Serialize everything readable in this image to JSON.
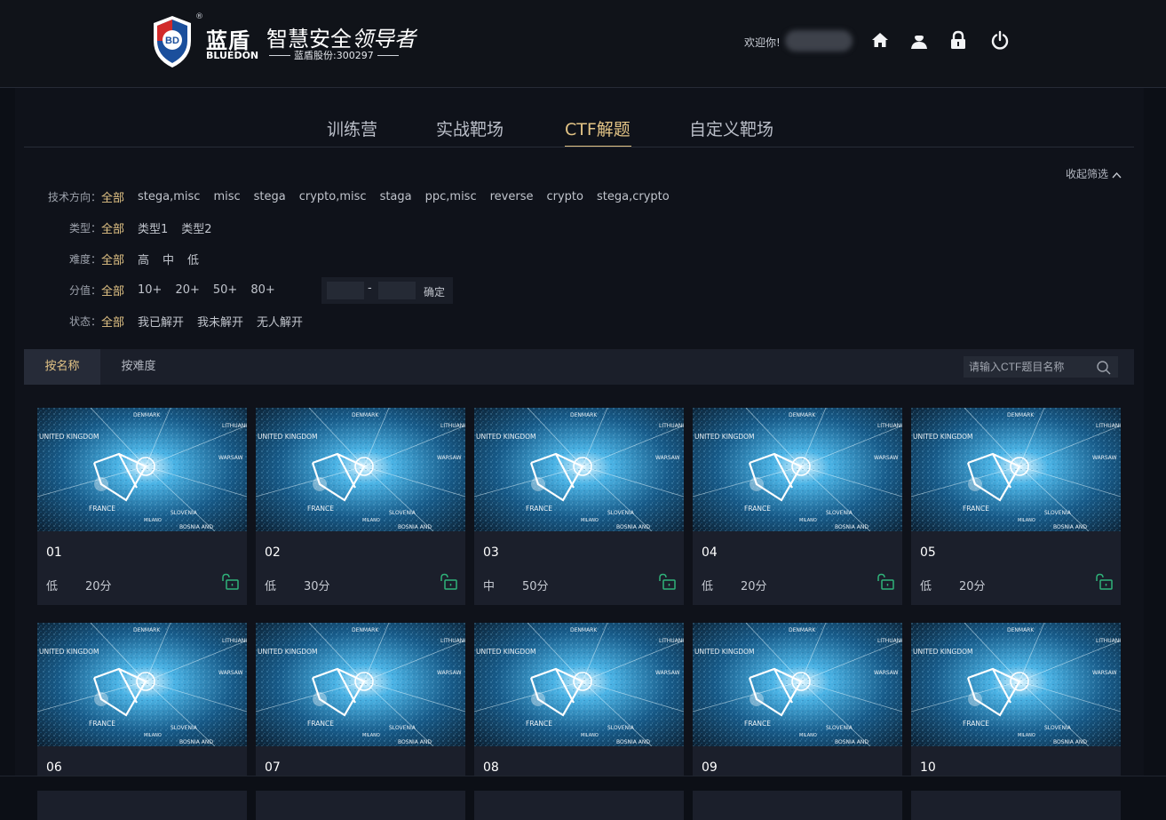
{
  "header": {
    "brand_cn": "蓝盾",
    "brand_en": "BLUEDON",
    "logo_mark": "BD",
    "slogan_plain": "智慧安全",
    "slogan_script": "领导者",
    "stock": "蓝盾股份:300297",
    "welcome": "欢迎你!",
    "icons": [
      "home-icon",
      "user-icon",
      "lock-icon",
      "power-icon"
    ]
  },
  "tabs": [
    "训练营",
    "实战靶场",
    "CTF解题",
    "自定义靶场"
  ],
  "active_tab": "CTF解题",
  "collapse_label": "收起筛选",
  "filters": {
    "direction": {
      "label": "技术方向：",
      "options": [
        "全部",
        "stega,misc",
        "misc",
        "stega",
        "crypto,misc",
        "staga",
        "ppc,misc",
        "reverse",
        "crypto",
        "stega,crypto"
      ]
    },
    "type": {
      "label": "类型：",
      "options": [
        "全部",
        "类型1",
        "类型2"
      ]
    },
    "difficulty": {
      "label": "难度：",
      "options": [
        "全部",
        "高",
        "中",
        "低"
      ]
    },
    "score": {
      "label": "分值：",
      "options": [
        "全部",
        "10+",
        "20+",
        "50+",
        "80+"
      ],
      "range_sep": "-",
      "confirm": "确定"
    },
    "status": {
      "label": "状态：",
      "options": [
        "全部",
        "我已解开",
        "我未解开",
        "无人解开"
      ]
    }
  },
  "sort": {
    "by_name": "按名称",
    "by_difficulty": "按难度",
    "active": "按名称"
  },
  "search": {
    "placeholder": "请输入CTF题目名称"
  },
  "thumb_labels": {
    "uk": "UNITED KINGDOM",
    "dk": "DENMARK",
    "lt": "LITHUANI",
    "fr": "FRANCE",
    "wa": "WARSAW",
    "sl": "SLOVENIA",
    "bo": "BOSNIA AND",
    "mi": "MILANO"
  },
  "cards": [
    {
      "title": "01",
      "difficulty": "低",
      "score": "20分"
    },
    {
      "title": "02",
      "difficulty": "低",
      "score": "30分"
    },
    {
      "title": "03",
      "difficulty": "中",
      "score": "50分"
    },
    {
      "title": "04",
      "difficulty": "低",
      "score": "20分"
    },
    {
      "title": "05",
      "difficulty": "低",
      "score": "20分"
    },
    {
      "title": "06",
      "difficulty": "",
      "score": ""
    },
    {
      "title": "07",
      "difficulty": "",
      "score": ""
    },
    {
      "title": "08",
      "difficulty": "",
      "score": ""
    },
    {
      "title": "09",
      "difficulty": "",
      "score": ""
    },
    {
      "title": "10",
      "difficulty": "",
      "score": ""
    }
  ],
  "colors": {
    "accent_gold": "#e3c486",
    "unlock_green": "#2fb37a",
    "background": "#0c0f16",
    "card": "#1b1f2b"
  }
}
